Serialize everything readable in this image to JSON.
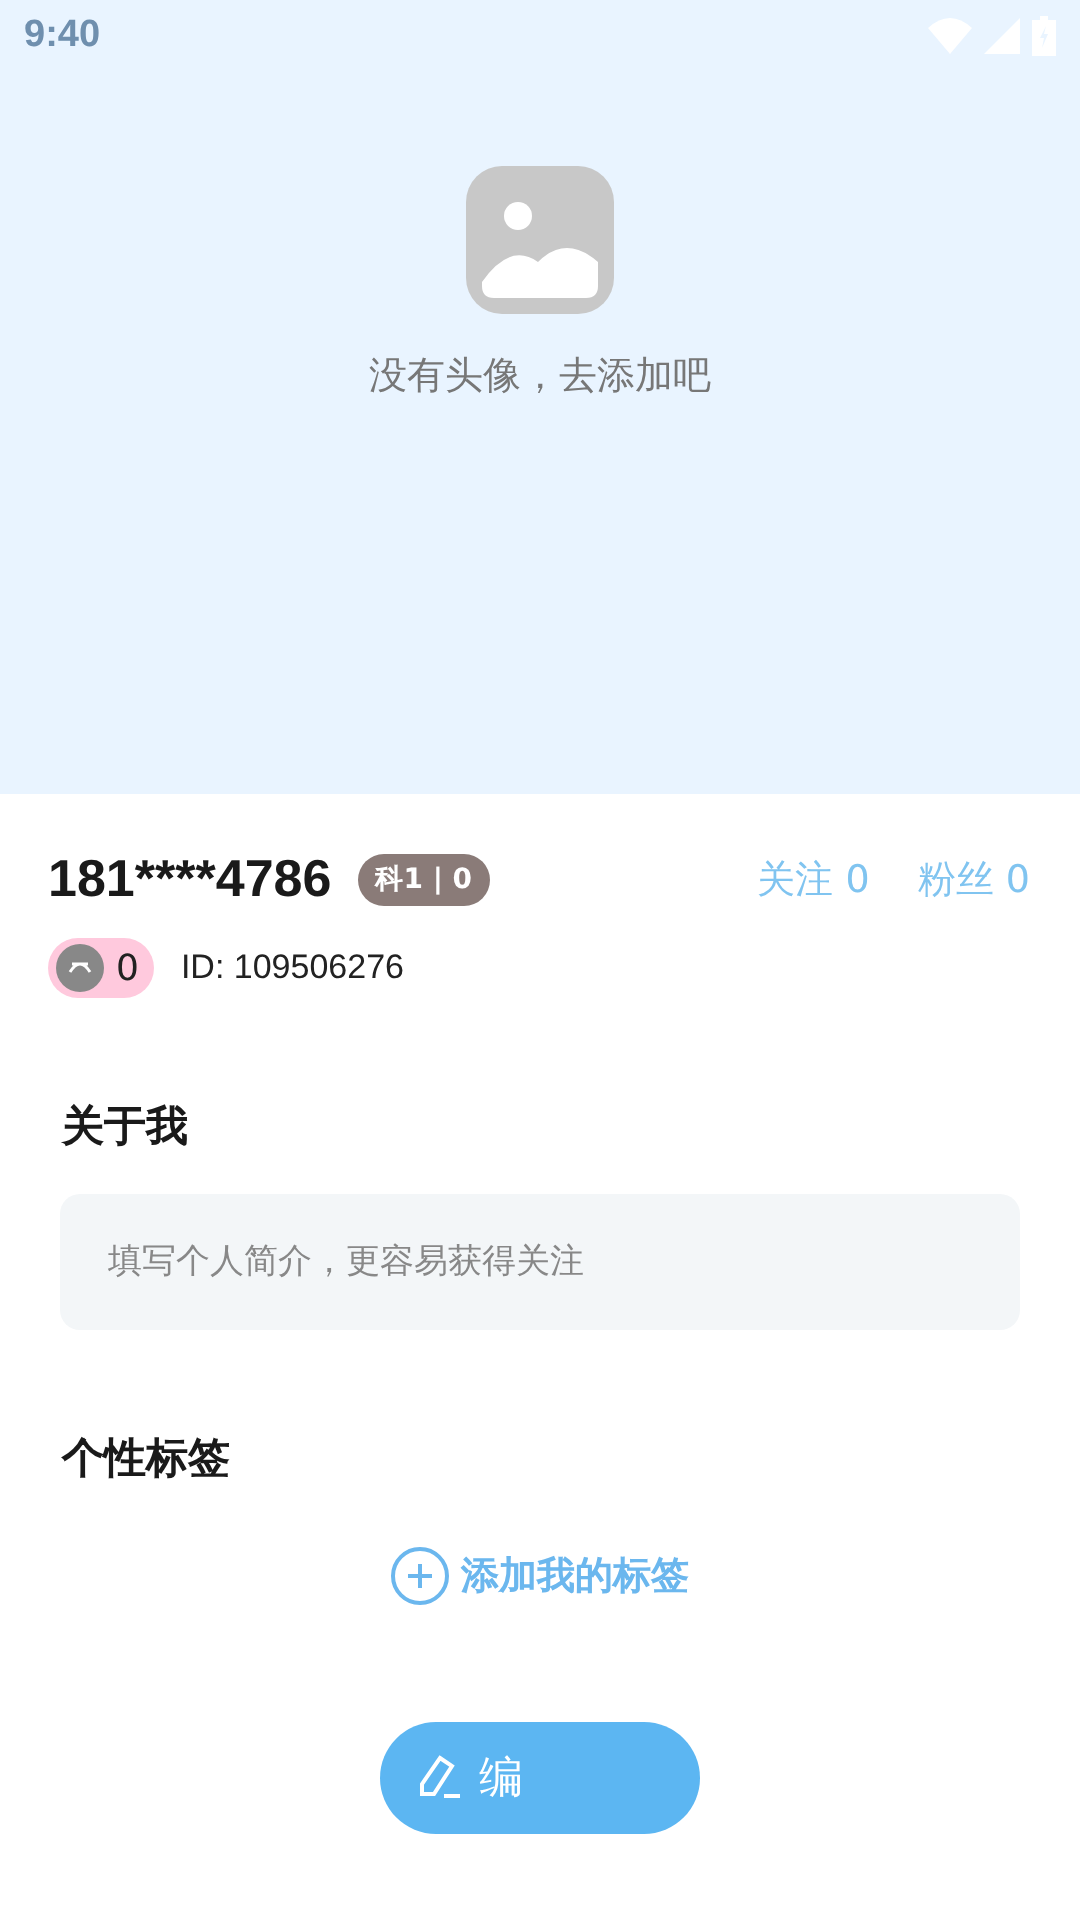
{
  "status_bar": {
    "time": "9:40"
  },
  "avatar": {
    "prompt": "没有头像，去添加吧"
  },
  "profile": {
    "name": "181****4786",
    "level_badge": "科1 | 0",
    "follow": "关注 0",
    "fans": "粉丝 0",
    "coins": "0",
    "id": "ID: 109506276"
  },
  "about": {
    "title": "关于我",
    "placeholder": "填写个人简介，更容易获得关注"
  },
  "tags": {
    "title": "个性标签",
    "add": "添加我的标签"
  },
  "edit_button": {
    "label": "编"
  }
}
